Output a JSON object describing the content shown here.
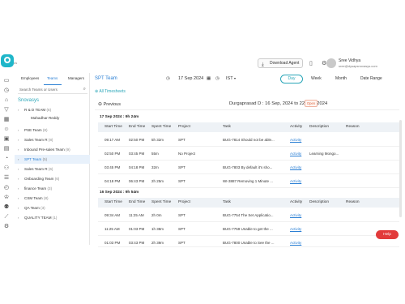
{
  "app": {
    "logo_text": "ds",
    "download_agent": "Download Agent",
    "user_name": "Sree Vidhya",
    "user_email": "sree@dysapsnovasys.com"
  },
  "side": {
    "tabs": [
      "Employees",
      "Teams",
      "Managers"
    ],
    "search_placeholder": "Search Teams or Users",
    "org": "Snovasys",
    "teams": [
      {
        "label": "R & D TEAM",
        "count": "(6)"
      },
      {
        "label": "Mahadhar Reddy",
        "count": ""
      },
      {
        "label": "PSE Team",
        "count": "(8)"
      },
      {
        "label": "Sales Team R",
        "count": "(8)"
      },
      {
        "label": "Inbound Pre-sales Team",
        "count": "(9)"
      },
      {
        "label": "SPT Team",
        "count": "(5)"
      },
      {
        "label": "Sales Team R",
        "count": "(6)"
      },
      {
        "label": "Onboarding Team",
        "count": "(6)"
      },
      {
        "label": "finance Team",
        "count": "(3)"
      },
      {
        "label": "CSM Team",
        "count": "(8)"
      },
      {
        "label": "QA Team",
        "count": "(3)"
      },
      {
        "label": "QUALITY TEAM",
        "count": "(1)"
      }
    ]
  },
  "main": {
    "title": "SPT Team",
    "date": "17 Sep 2024",
    "timezone": "IST",
    "view_toggles": [
      "Day",
      "Week",
      "Month",
      "Date Range"
    ],
    "all_timesheets": "All Timesheets",
    "previous": "Previous",
    "period_header": "Durgaprasad D : 16 Sep, 2024 to 22 Sep, 2024",
    "status_badge": "Open",
    "columns": [
      "Start Time",
      "End Time",
      "Spent Time",
      "Project",
      "Task",
      "Activity",
      "Description",
      "Reason"
    ],
    "groups": [
      {
        "date": "17 Sep 2024 : 9h 24m",
        "rows": [
          [
            "09:17 AM",
            "02:50 PM",
            "5h 32m",
            "SPT",
            "BUG-7814 Should not be able...",
            "Activity",
            "",
            ""
          ],
          [
            "02:50 PM",
            "03:45 PM",
            "55m",
            "No Project",
            "",
            "Activity",
            "Learning Mongo...",
            ""
          ],
          [
            "03:45 PM",
            "04:18 PM",
            "32m",
            "SPT",
            "BUG-7803 By default it's sho...",
            "Activity",
            "",
            ""
          ],
          [
            "04:18 PM",
            "06:43 PM",
            "2h 25m",
            "SPT",
            "WI-3887 Removing 1 Minute ...",
            "Activity",
            "",
            ""
          ]
        ]
      },
      {
        "date": "16 Sep 2024 : 9h 54m",
        "rows": [
          [
            "09:34 AM",
            "11:25 AM",
            "2h 0m",
            "SPT",
            "BUG-7754 The Set Applicatio...",
            "Activity",
            "",
            ""
          ],
          [
            "11:25 AM",
            "01:03 PM",
            "1h 38m",
            "SPT",
            "BUG-7759 Unable to get the ...",
            "Activity",
            "",
            ""
          ],
          [
            "01:03 PM",
            "03:43 PM",
            "2h 39m",
            "SPT",
            "BUG-7800 Unable to See the ...",
            "Activity",
            "",
            ""
          ]
        ]
      }
    ]
  },
  "help": "Help"
}
